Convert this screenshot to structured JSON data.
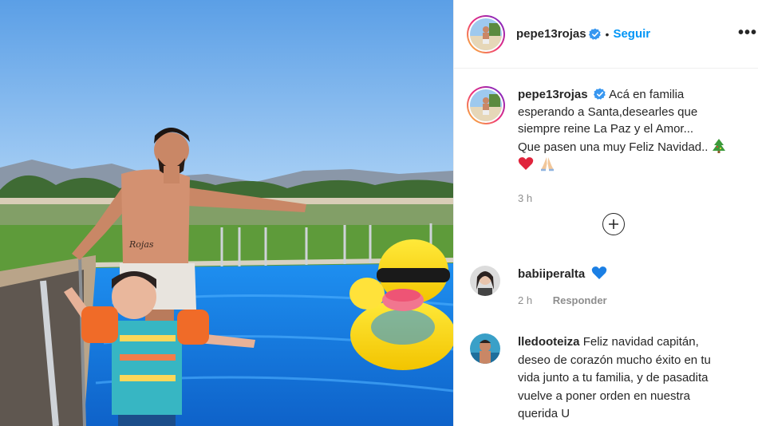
{
  "post": {
    "username": "pepe13rojas",
    "follow_label": "Seguir",
    "more_label": "•••",
    "dot": "•",
    "caption_lines": [
      "Acá en familia",
      "esperando a Santa,desearles que",
      "siempre reine La Paz y el Amor...",
      "Que pasen una muy Feliz Navidad.."
    ],
    "caption_emojis": [
      "christmas-tree",
      "red-heart",
      "folded-hands"
    ],
    "timestamp": "3 h",
    "load_more": "+"
  },
  "comments": [
    {
      "username": "babiiperalta",
      "text": "",
      "emoji": "blue-heart",
      "time": "2 h",
      "reply_label": "Responder"
    },
    {
      "username": "lledooteiza",
      "text": "Feliz navidad capitán, deseo de corazón mucho éxito en tu vida junto a tu familia, y de pasadita vuelve a poner orden en nuestra querida U",
      "lines": [
        "Feliz navidad capitán,",
        "deseo de corazón mucho éxito en tu",
        "vida junto a tu familia, y de pasadita",
        "vuelve a poner orden en nuestra",
        "querida U"
      ]
    }
  ],
  "photo": {
    "arm_tattoo": "Rojas"
  },
  "colors": {
    "link": "#0095f6",
    "verified": "#3897f0",
    "muted": "#8e8e8e",
    "text": "#262626"
  }
}
